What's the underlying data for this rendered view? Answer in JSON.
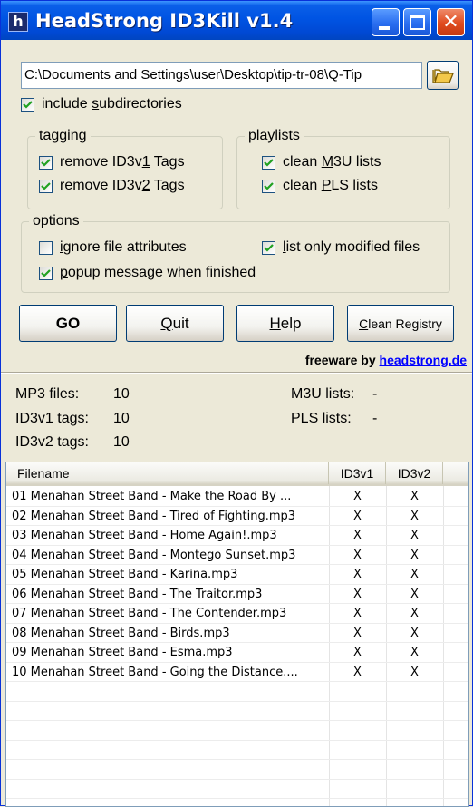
{
  "window": {
    "title": "HeadStrong ID3Kill v1.4",
    "icon_letter": "h",
    "minimize_icon": "minimize-icon",
    "maximize_icon": "maximize-icon",
    "close_icon": "close-icon",
    "close_glyph": "✕"
  },
  "path": {
    "value": "C:\\Documents and Settings\\user\\Desktop\\tip-tr-08\\Q-Tip",
    "browse_icon": "folder-open-icon"
  },
  "include_subdirs": {
    "pre": "include ",
    "u": "s",
    "post": "ubdirectories",
    "checked": true
  },
  "tagging": {
    "title": "tagging",
    "remove_v1": {
      "pre": "remove ID3v",
      "u": "1",
      "post": " Tags",
      "checked": true
    },
    "remove_v2": {
      "pre": "remove ID3v",
      "u": "2",
      "post": " Tags",
      "checked": true
    }
  },
  "playlists": {
    "title": "playlists",
    "clean_m3u": {
      "pre": "clean ",
      "u": "M",
      "post": "3U lists",
      "checked": true
    },
    "clean_pls": {
      "pre": "clean ",
      "u": "P",
      "post": "LS lists",
      "checked": true
    }
  },
  "options": {
    "title": "options",
    "ignore_attr": {
      "pre": "",
      "u": "i",
      "post": "gnore file attributes",
      "checked": false
    },
    "list_modified": {
      "pre": "",
      "u": "l",
      "post": "ist only modified files",
      "checked": true
    },
    "popup_msg": {
      "pre": "",
      "u": "p",
      "post": "opup message when finished",
      "checked": true
    }
  },
  "buttons": {
    "go": "GO",
    "quit": {
      "u": "Q",
      "post": "uit"
    },
    "help": {
      "u": "H",
      "post": "elp"
    },
    "clean_registry": {
      "u": "C",
      "post": "lean Registry"
    }
  },
  "freeware": {
    "text": "freeware by ",
    "link": "headstrong.de"
  },
  "stats": {
    "mp3_label": "MP3 files:",
    "mp3_value": "10",
    "v1_label": "ID3v1 tags:",
    "v1_value": "10",
    "v2_label": "ID3v2 tags:",
    "v2_value": "10",
    "m3u_label": "M3U lists:",
    "m3u_value": "-",
    "pls_label": "PLS lists:",
    "pls_value": "-"
  },
  "list": {
    "columns": [
      "Filename",
      "ID3v1",
      "ID3v2"
    ],
    "rows": [
      [
        "01 Menahan Street Band - Make the Road By ...",
        "X",
        "X"
      ],
      [
        "02 Menahan Street Band - Tired of Fighting.mp3",
        "X",
        "X"
      ],
      [
        "03 Menahan Street Band - Home Again!.mp3",
        "X",
        "X"
      ],
      [
        "04 Menahan Street Band - Montego Sunset.mp3",
        "X",
        "X"
      ],
      [
        "05 Menahan Street Band - Karina.mp3",
        "X",
        "X"
      ],
      [
        "06 Menahan Street Band - The Traitor.mp3",
        "X",
        "X"
      ],
      [
        "07 Menahan Street Band - The Contender.mp3",
        "X",
        "X"
      ],
      [
        "08 Menahan Street Band - Birds.mp3",
        "X",
        "X"
      ],
      [
        "09 Menahan Street Band - Esma.mp3",
        "X",
        "X"
      ],
      [
        "10 Menahan Street Band - Going the Distance....",
        "X",
        "X"
      ]
    ]
  }
}
